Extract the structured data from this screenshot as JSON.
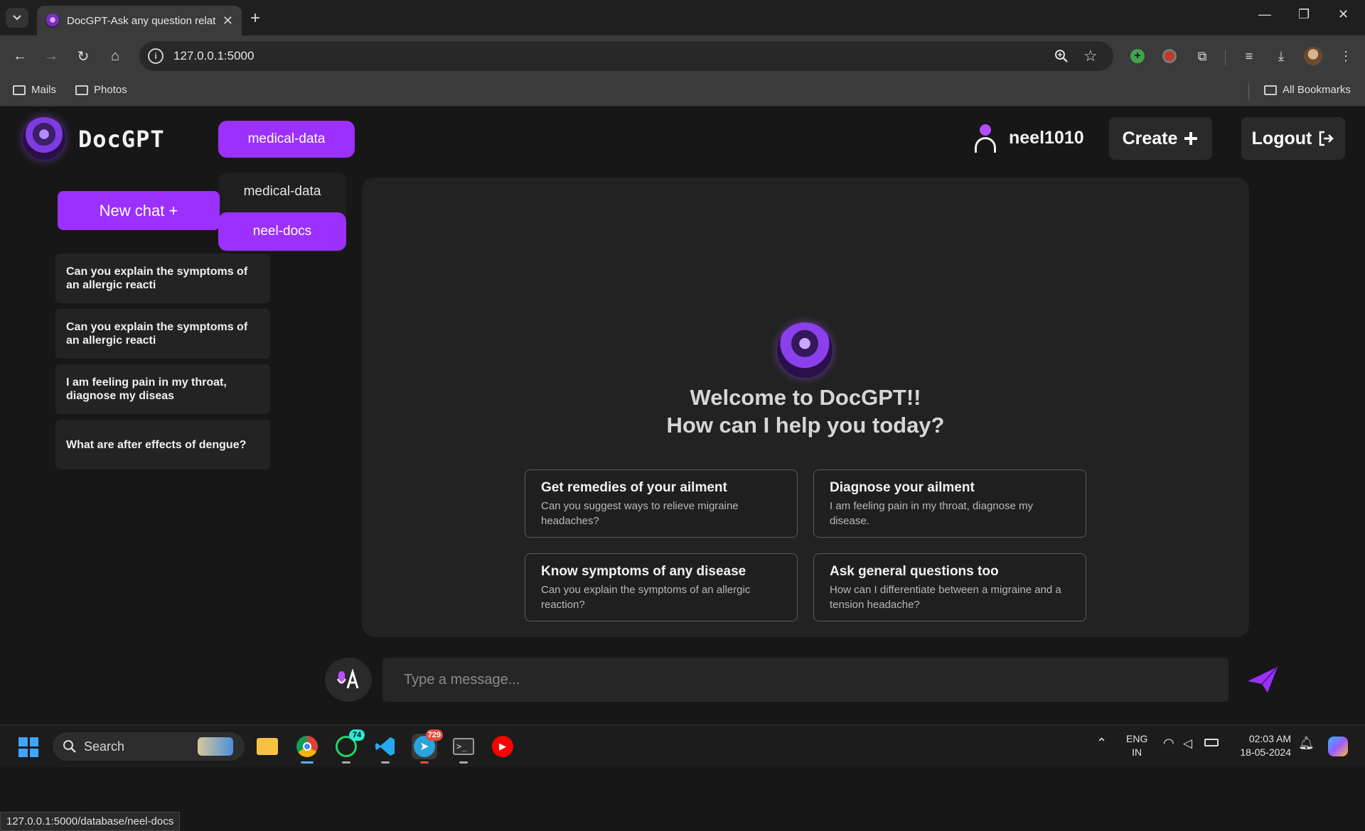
{
  "browser": {
    "tab_title": "DocGPT-Ask any question relat",
    "url": "127.0.0.1:5000",
    "bookmarks": [
      {
        "label": "Mails"
      },
      {
        "label": "Photos"
      }
    ],
    "all_bookmarks": "All Bookmarks",
    "status_url": "127.0.0.1:5000/database/neel-docs"
  },
  "header": {
    "brand": "DocGPT",
    "selected_database": "medical-data",
    "database_options": [
      "medical-data",
      "neel-docs"
    ],
    "active_option": "neel-docs",
    "username": "neel1010",
    "create_label": "Create",
    "logout_label": "Logout"
  },
  "sidebar": {
    "new_chat_label": "New chat +",
    "history": [
      {
        "text": "Can you explain the symptoms of an allergic reacti"
      },
      {
        "text": "Can you explain the symptoms of an allergic reacti"
      },
      {
        "text": "I am feeling pain in my throat, diagnose my diseas"
      },
      {
        "text": "What are after effects of dengue?"
      }
    ]
  },
  "main": {
    "welcome_line1": "Welcome to DocGPT!!",
    "welcome_line2": "How can I help you today?",
    "cards": [
      {
        "title": "Get remedies of your ailment",
        "subtitle": "Can you suggest ways to relieve migraine headaches?"
      },
      {
        "title": "Diagnose your ailment",
        "subtitle": "I am feeling pain in my throat, diagnose my disease."
      },
      {
        "title": "Know symptoms of any disease",
        "subtitle": "Can you explain the symptoms of an allergic reaction?"
      },
      {
        "title": "Ask general questions too",
        "subtitle": "How can I differentiate between a migraine and a tension headache?"
      }
    ]
  },
  "composer": {
    "placeholder": "Type a message..."
  },
  "taskbar": {
    "search_label": "Search",
    "whatsapp_badge": "74",
    "telegram_badge": "729",
    "lang_line1": "ENG",
    "lang_line2": "IN",
    "time": "02:03 AM",
    "date": "18-05-2024"
  },
  "colors": {
    "accent": "#9b30ff",
    "background": "#171717",
    "panel": "#222222"
  },
  "icons": [
    "search-icon",
    "star-icon",
    "mic-icon",
    "send-icon",
    "user-icon",
    "plus-icon",
    "logout-icon"
  ]
}
